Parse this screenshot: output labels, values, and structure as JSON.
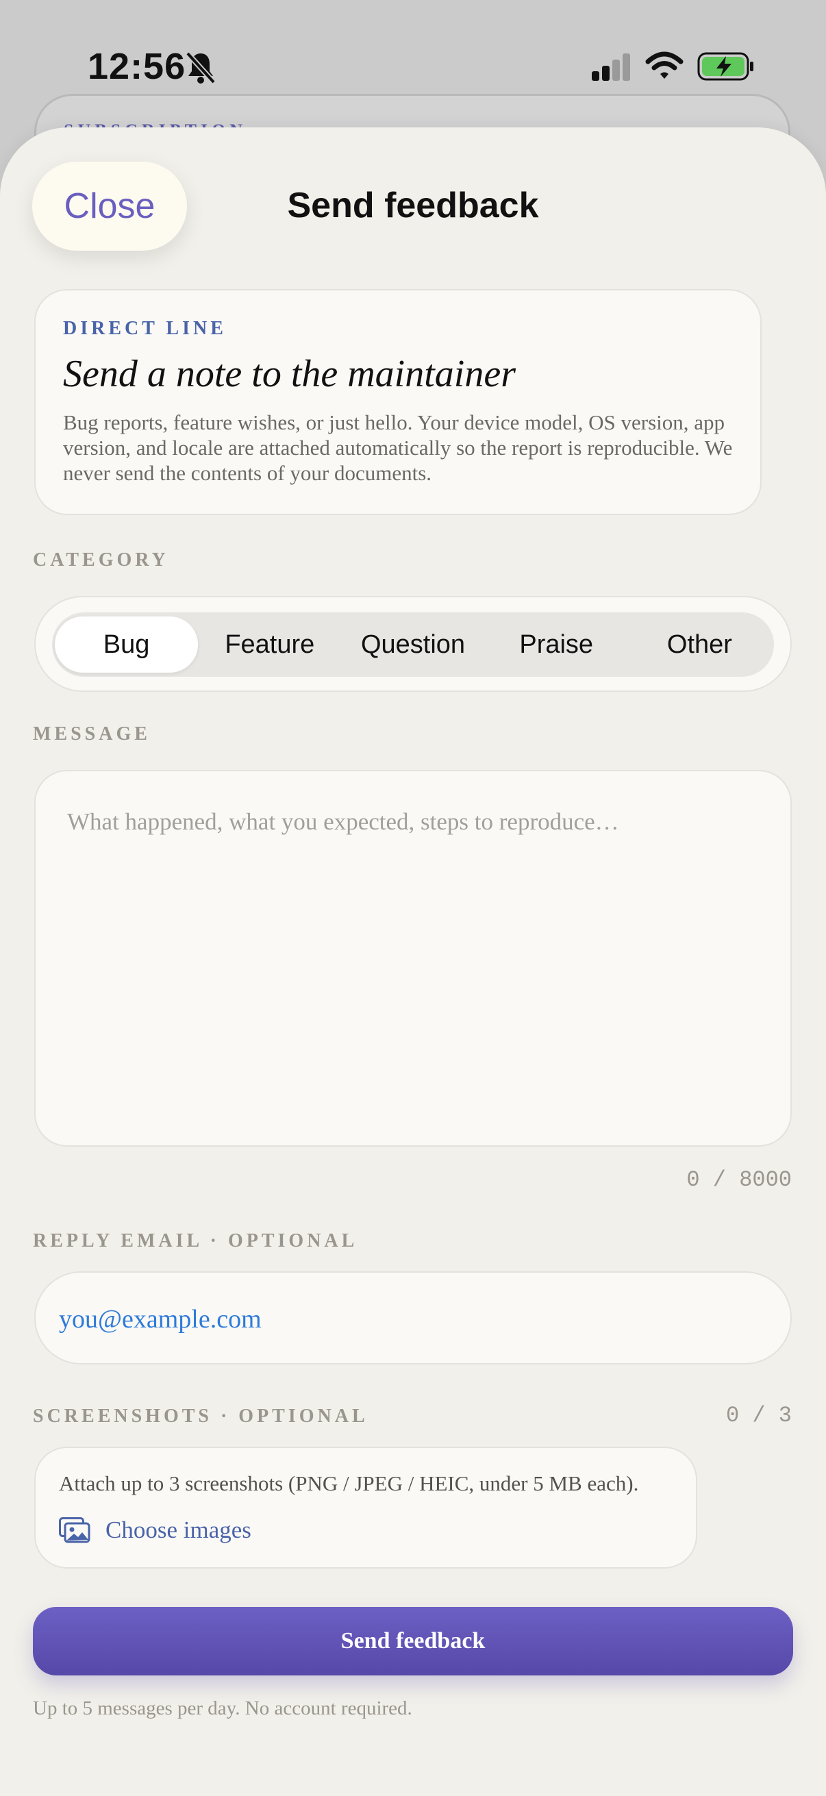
{
  "status_bar": {
    "time": "12:56"
  },
  "behind": {
    "label": "SUBSCRIPTION"
  },
  "header": {
    "close_label": "Close",
    "title": "Send feedback"
  },
  "intro": {
    "eyebrow": "DIRECT LINE",
    "title": "Send a note to the maintainer",
    "body": "Bug reports, feature wishes, or just hello. Your device model, OS version, app version, and locale are attached automatically so the report is reproducible. We never send the contents of your documents."
  },
  "category": {
    "label": "CATEGORY",
    "selected": "Bug",
    "options": [
      "Bug",
      "Feature",
      "Question",
      "Praise",
      "Other"
    ]
  },
  "message": {
    "label": "MESSAGE",
    "placeholder": "What happened, what you expected, steps to reproduce…",
    "value": "",
    "counter": "0 / 8000"
  },
  "email": {
    "label": "REPLY EMAIL · OPTIONAL",
    "placeholder": "you@example.com"
  },
  "screenshots": {
    "label": "SCREENSHOTS · OPTIONAL",
    "count": "0 / 3",
    "help": "Attach up to 3 screenshots (PNG / JPEG / HEIC, under 5 MB each).",
    "choose_label": "Choose images"
  },
  "send": {
    "label": "Send feedback"
  },
  "footnote": "Up to 5 messages per day. No account required.",
  "colors": {
    "accent": "#6a5fbf",
    "link": "#4a64a8",
    "email": "#2e6fd6",
    "battery": "#5fc85a"
  }
}
